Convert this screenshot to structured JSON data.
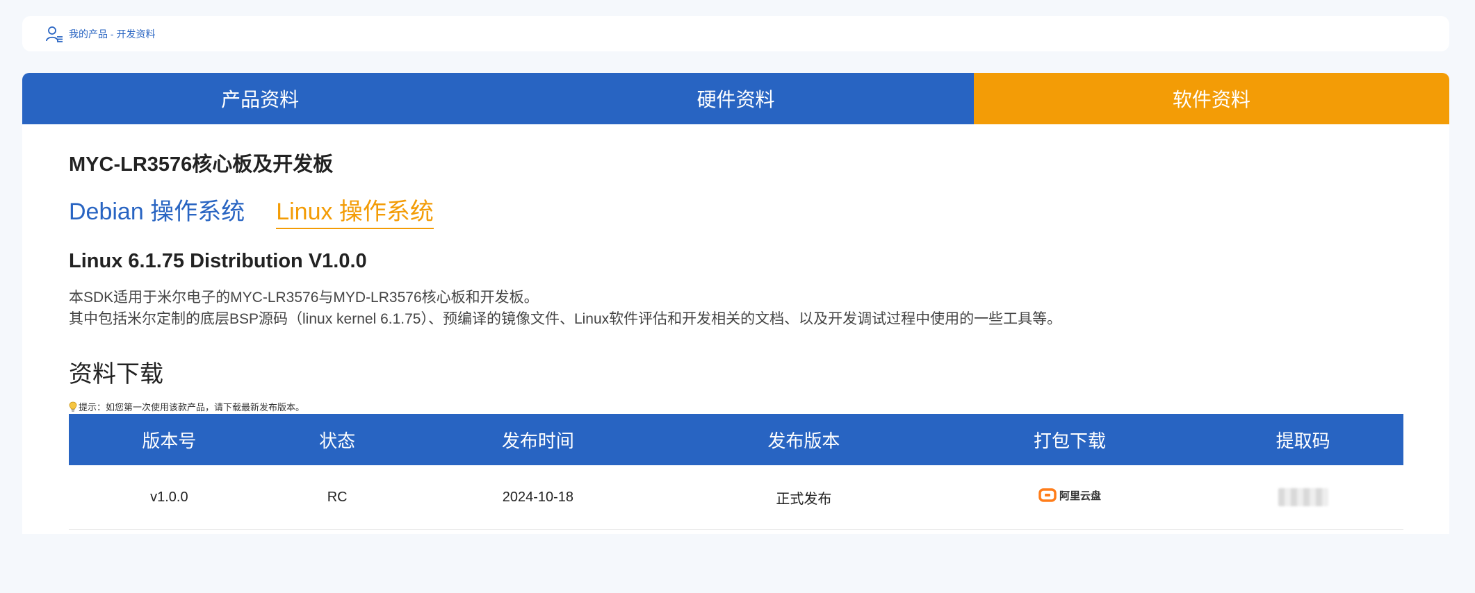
{
  "breadcrumb": {
    "text": "我的产品 - 开发资料"
  },
  "tabs": [
    {
      "label": "产品资料",
      "active": false
    },
    {
      "label": "硬件资料",
      "active": false
    },
    {
      "label": "软件资料",
      "active": true
    }
  ],
  "product_title": "MYC-LR3576核心板及开发板",
  "os_tabs": [
    {
      "label": "Debian 操作系统",
      "active": false
    },
    {
      "label": "Linux 操作系统",
      "active": true
    }
  ],
  "distribution_title": "Linux 6.1.75 Distribution V1.0.0",
  "description": [
    "本SDK适用于米尔电子的MYC-LR3576与MYD-LR3576核心板和开发板。",
    "其中包括米尔定制的底层BSP源码（linux kernel 6.1.75）、预编译的镜像文件、Linux软件评估和开发相关的文档、以及开发调试过程中使用的一些工具等。"
  ],
  "download_section": {
    "title": "资料下载",
    "tip": "提示：如您第一次使用该款产品，请下载最新发布版本。",
    "columns": [
      "版本号",
      "状态",
      "发布时间",
      "发布版本",
      "打包下载",
      "提取码"
    ],
    "rows": [
      {
        "version": "v1.0.0",
        "status": "RC",
        "date": "2024-10-18",
        "release": "正式发布",
        "download_label": "阿里云盘"
      }
    ]
  },
  "colors": {
    "primary": "#2864c2",
    "accent": "#f39c06",
    "background": "#f5f8fc"
  },
  "icons": {
    "breadcrumb": "user-list-icon",
    "tip": "lightbulb-icon",
    "download": "aliyun-drive-icon"
  }
}
